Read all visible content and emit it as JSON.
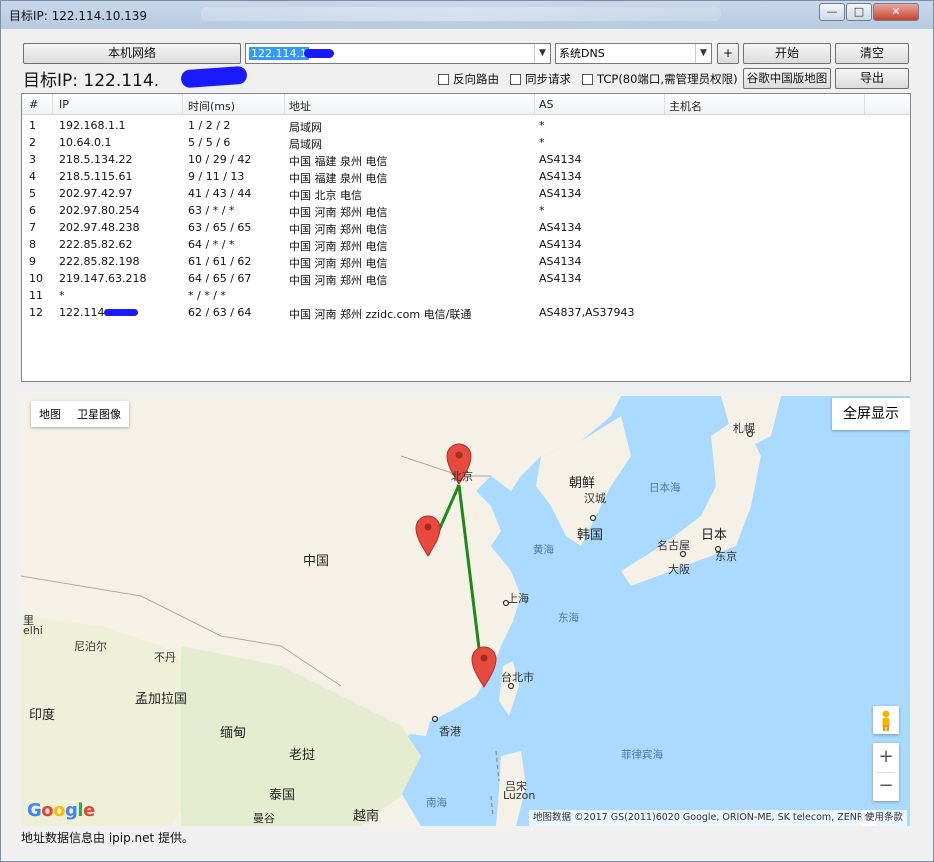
{
  "window": {
    "title": "目标IP: 122.114.10.139",
    "controls": {
      "minimize": "—",
      "maximize": "□",
      "close": "✕"
    }
  },
  "toolbar": {
    "local_network_label": "本机网络",
    "target_value": "122.114.1",
    "dns_value": "系统DNS",
    "plus_label": "+",
    "start_label": "开始",
    "clear_label": "清空",
    "google_map_label": "谷歌中国版地图",
    "export_label": "导出",
    "big_target_label": "目标IP:  122.114.",
    "options": {
      "reverse_route": "反向路由",
      "sync_request": "同步请求",
      "tcp": "TCP(80端口,需管理员权限)"
    }
  },
  "table": {
    "columns": [
      "#",
      "IP",
      "时间(ms)",
      "地址",
      "AS",
      "主机名"
    ],
    "rows": [
      {
        "n": "1",
        "ip": "192.168.1.1",
        "time": "1 / 2 / 2",
        "addr": "局域网",
        "as": "*",
        "host": ""
      },
      {
        "n": "2",
        "ip": "10.64.0.1",
        "time": "5 / 5 / 6",
        "addr": "局域网",
        "as": "*",
        "host": ""
      },
      {
        "n": "3",
        "ip": "218.5.134.22",
        "time": "10 / 29 / 42",
        "addr": "中国 福建 泉州 电信",
        "as": "AS4134",
        "host": ""
      },
      {
        "n": "4",
        "ip": "218.5.115.61",
        "time": "9 / 11 / 13",
        "addr": "中国 福建 泉州 电信",
        "as": "AS4134",
        "host": ""
      },
      {
        "n": "5",
        "ip": "202.97.42.97",
        "time": "41 / 43 / 44",
        "addr": "中国 北京 电信",
        "as": "AS4134",
        "host": ""
      },
      {
        "n": "6",
        "ip": "202.97.80.254",
        "time": "63 / * / *",
        "addr": "中国 河南 郑州 电信",
        "as": "*",
        "host": ""
      },
      {
        "n": "7",
        "ip": "202.97.48.238",
        "time": "63 / 65 / 65",
        "addr": "中国 河南 郑州 电信",
        "as": "AS4134",
        "host": ""
      },
      {
        "n": "8",
        "ip": "222.85.82.62",
        "time": "64 / * / *",
        "addr": "中国 河南 郑州 电信",
        "as": "AS4134",
        "host": ""
      },
      {
        "n": "9",
        "ip": "222.85.82.198",
        "time": "61 / 61 / 62",
        "addr": "中国 河南 郑州 电信",
        "as": "AS4134",
        "host": ""
      },
      {
        "n": "10",
        "ip": "219.147.63.218",
        "time": "64 / 65 / 67",
        "addr": "中国 河南 郑州 电信",
        "as": "AS4134",
        "host": ""
      },
      {
        "n": "11",
        "ip": "*",
        "time": "* / * / *",
        "addr": "",
        "as": "",
        "host": ""
      },
      {
        "n": "12",
        "ip": "122.114.",
        "time": "62 / 63 / 64",
        "addr": "中国 河南 郑州 zzidc.com 电信/联通",
        "as": "AS4837,AS37943",
        "host": ""
      }
    ]
  },
  "map": {
    "type_map": "地图",
    "type_satellite": "卫星图像",
    "fullscreen": "全屏显示",
    "labels": {
      "beijing": "北京",
      "china": "中国",
      "korea_n": "朝鲜",
      "seoul": "汉城",
      "korea_s": "韩国",
      "japan": "日本",
      "sea_japan": "日本海",
      "tokyo": "东京",
      "nagoya": "名古屋",
      "osaka": "大阪",
      "sapporo": "札幌",
      "yellow_sea": "黄海",
      "shanghai": "上海",
      "east_sea": "东海",
      "taipei": "台北市",
      "hongkong": "香港",
      "south_sea": "南海",
      "philippine_sea": "菲律宾海",
      "luzon_cn": "吕宋",
      "luzon": "Luzon",
      "nepal": "尼泊尔",
      "bhutan": "不丹",
      "bangladesh": "孟加拉国",
      "india": "印度",
      "myanmar": "缅甸",
      "laos": "老挝",
      "thailand": "泰国",
      "vietnam": "越南",
      "bangkok": "曼谷",
      "delhi_a": "里",
      "delhi_b": "elhi"
    },
    "zoom_in": "+",
    "zoom_out": "−",
    "attribution": "地图数据 ©2017 GS(2011)6020 Google, ORION-ME, SK telecom, ZENRIN",
    "terms": "使用条款",
    "logo": "Google"
  },
  "status": "地址数据信息由 ipip.net 提供。",
  "colors": {
    "route": "#1a8a1a",
    "pin": "#e84a3f",
    "scribble": "#1a1aff"
  }
}
